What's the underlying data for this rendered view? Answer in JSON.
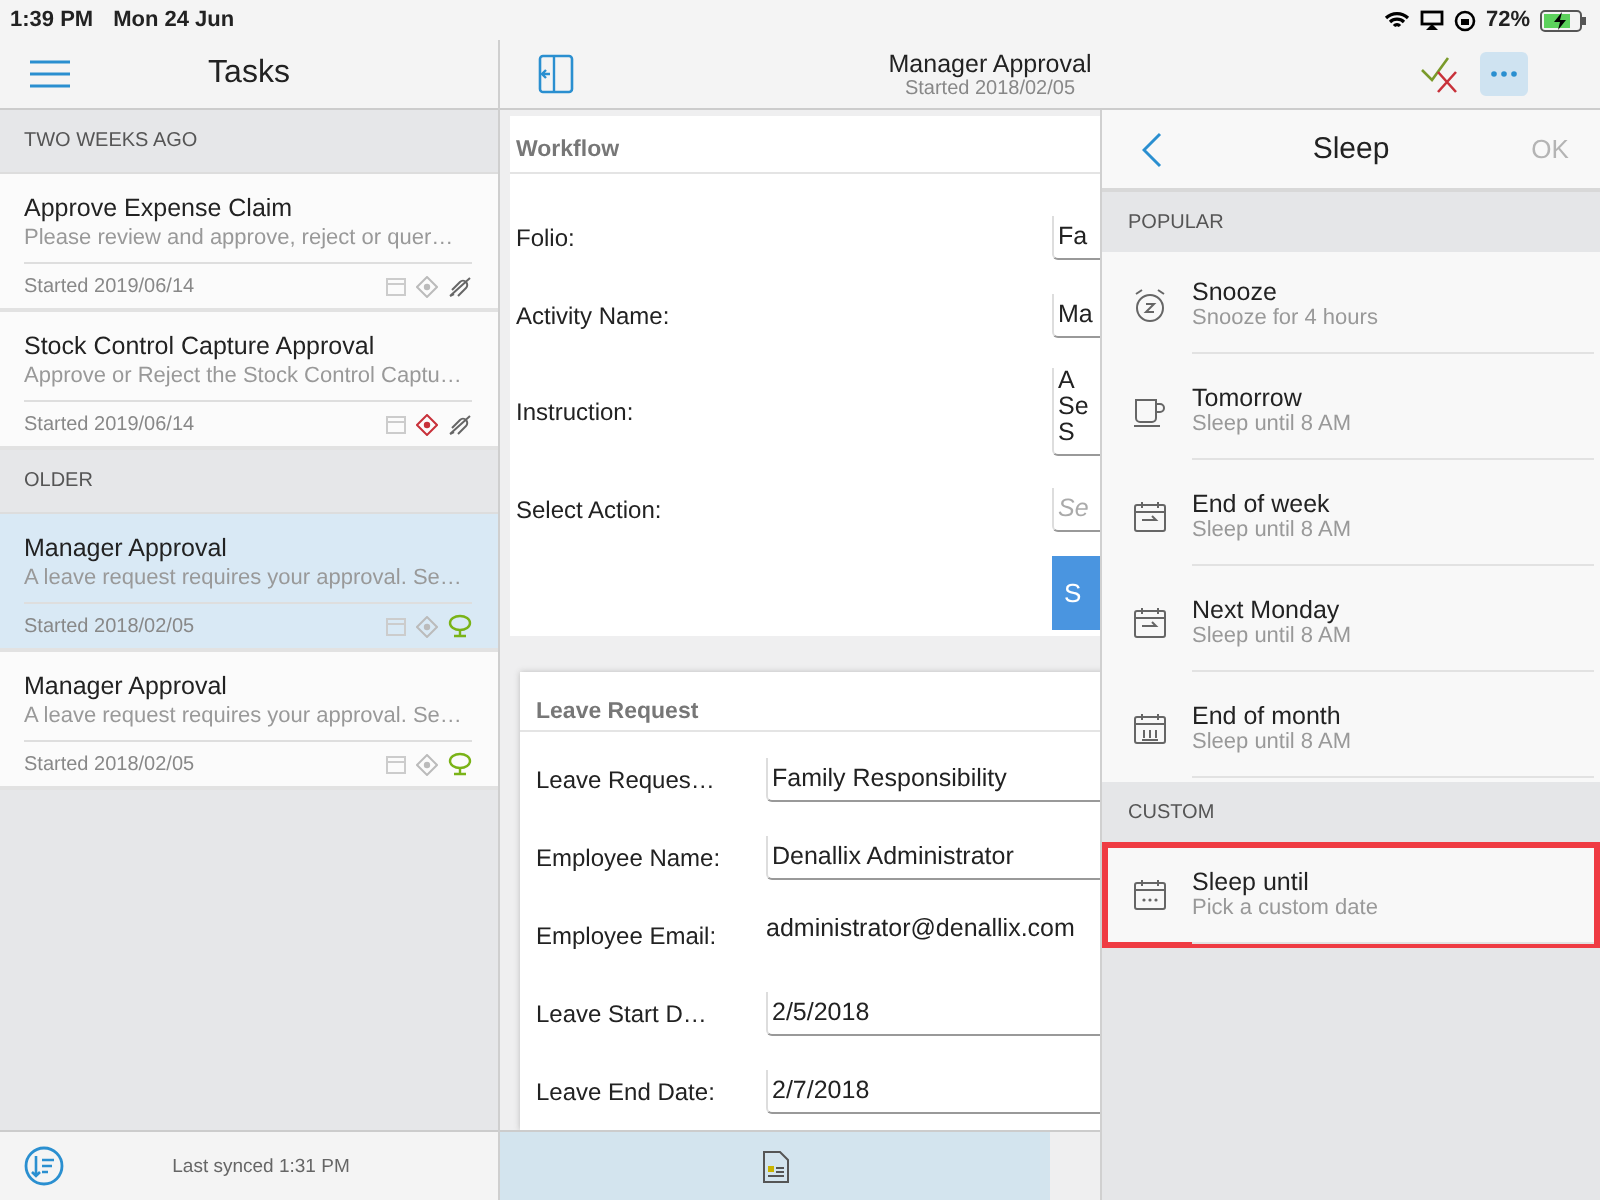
{
  "status_bar": {
    "time": "1:39 PM",
    "date": "Mon 24 Jun",
    "battery": "72%"
  },
  "sidebar": {
    "title": "Tasks",
    "sections": [
      {
        "heading": "TWO WEEKS AGO",
        "tasks": [
          {
            "title": "Approve Expense Claim",
            "summary": "Please review and approve, reject or quer…",
            "started": "Started 2019/06/14",
            "selected": false,
            "flagged": false,
            "synced": false
          },
          {
            "title": "Stock Control Capture Approval",
            "summary": "Approve or Reject the Stock Control Captu…",
            "started": "Started 2019/06/14",
            "selected": false,
            "flagged": true,
            "synced": false
          }
        ]
      },
      {
        "heading": "OLDER",
        "tasks": [
          {
            "title": "Manager Approval",
            "summary": "A leave request requires your approval. Se…",
            "started": "Started 2018/02/05",
            "selected": true,
            "flagged": false,
            "synced": true
          },
          {
            "title": "Manager Approval",
            "summary": "A leave request requires your approval. Se…",
            "started": "Started 2018/02/05",
            "selected": false,
            "flagged": false,
            "synced": true
          }
        ]
      }
    ],
    "footer": "Last synced 1:31 PM"
  },
  "detail": {
    "title": "Manager Approval",
    "subtitle": "Started 2018/02/05",
    "workflow": {
      "heading": "Workflow",
      "fields": [
        {
          "kind": "field",
          "label": "Folio:",
          "value": "Fa"
        },
        {
          "kind": "field",
          "label": "Activity Name:",
          "value": "Ma"
        },
        {
          "kind": "multiline",
          "label": "Instruction:",
          "lines": [
            "A",
            "Se",
            "S"
          ]
        },
        {
          "kind": "picker",
          "label": "Select Action:",
          "placeholder": "Se"
        }
      ],
      "button": "S"
    },
    "leave_request": {
      "heading": "Leave Request",
      "fields": [
        {
          "kind": "field",
          "label": "Leave Reques…",
          "value": "Family Responsibility"
        },
        {
          "kind": "field",
          "label": "Employee Name:",
          "value": "Denallix Administrator"
        },
        {
          "kind": "text",
          "label": "Employee Email:",
          "value": "administrator@denallix.com"
        },
        {
          "kind": "field",
          "label": "Leave Start D…",
          "value": "2/5/2018"
        },
        {
          "kind": "field",
          "label": "Leave End Date:",
          "value": "2/7/2018"
        }
      ]
    }
  },
  "sleep": {
    "title": "Sleep",
    "ok": {
      "label": "OK",
      "disabled": true
    },
    "sections": [
      {
        "heading": "POPULAR",
        "items": [
          {
            "kind": "alarm",
            "title": "Snooze",
            "subtitle": "Snooze for 4 hours",
            "highlighted": false
          },
          {
            "kind": "cup",
            "title": "Tomorrow",
            "subtitle": "Sleep until 8 AM",
            "highlighted": false
          },
          {
            "kind": "week",
            "title": "End of week",
            "subtitle": "Sleep until 8 AM",
            "highlighted": false
          },
          {
            "kind": "week",
            "title": "Next Monday",
            "subtitle": "Sleep until 8 AM",
            "highlighted": false
          },
          {
            "kind": "month",
            "title": "End of month",
            "subtitle": "Sleep until 8 AM",
            "highlighted": false
          }
        ]
      },
      {
        "heading": "CUSTOM",
        "items": [
          {
            "kind": "custom",
            "title": "Sleep until",
            "subtitle": "Pick a custom date",
            "highlighted": true
          }
        ]
      }
    ]
  }
}
